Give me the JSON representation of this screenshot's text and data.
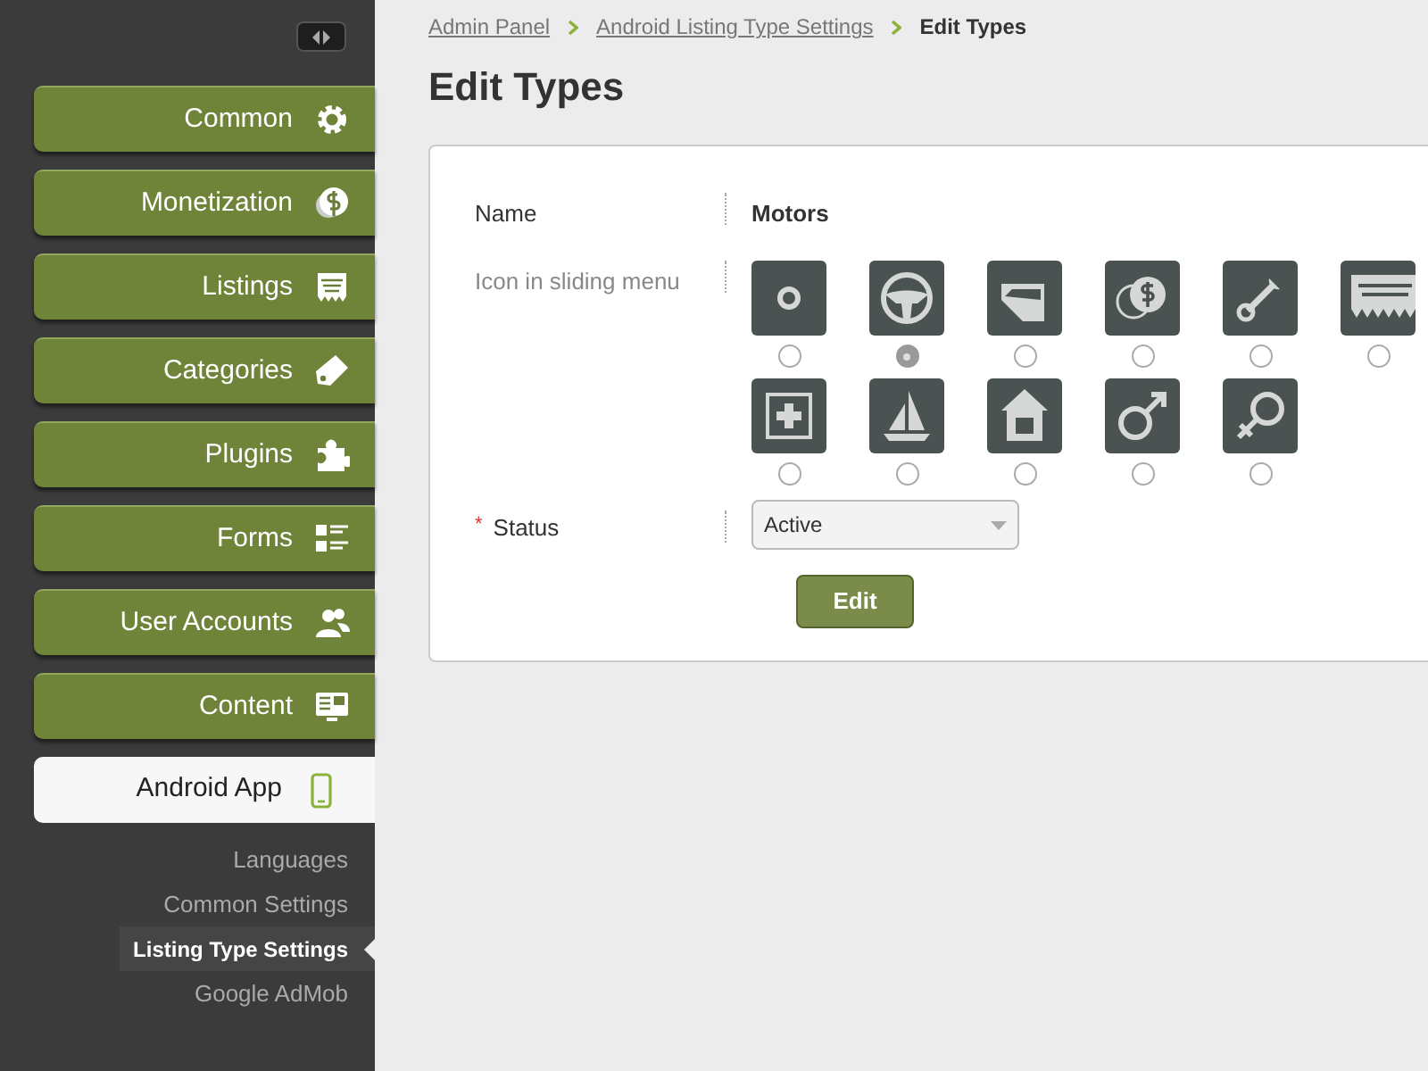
{
  "sidebar": {
    "items": [
      {
        "label": "Common",
        "kind": "gear",
        "selected": false
      },
      {
        "label": "Monetization",
        "kind": "coin",
        "selected": false
      },
      {
        "label": "Listings",
        "kind": "listing",
        "selected": false
      },
      {
        "label": "Categories",
        "kind": "tag",
        "selected": false
      },
      {
        "label": "Plugins",
        "kind": "puzzle",
        "selected": false
      },
      {
        "label": "Forms",
        "kind": "checklist",
        "selected": false
      },
      {
        "label": "User Accounts",
        "kind": "users",
        "selected": false
      },
      {
        "label": "Content",
        "kind": "screen",
        "selected": false
      },
      {
        "label": "Android App",
        "kind": "phone",
        "selected": true,
        "children": [
          {
            "label": "Languages",
            "selected": false
          },
          {
            "label": "Common Settings",
            "selected": false
          },
          {
            "label": "Listing Type Settings",
            "selected": true
          },
          {
            "label": "Google AdMob",
            "selected": false
          }
        ]
      }
    ]
  },
  "breadcrumb": [
    {
      "label": "Admin Panel",
      "kind": "link"
    },
    {
      "label": "Android Listing Type Settings",
      "kind": "link"
    },
    {
      "label": "Edit Types",
      "kind": "current"
    }
  ],
  "title": "Edit Types",
  "form": {
    "name": {
      "label": "Name",
      "value": "Motors"
    },
    "icon_field": {
      "label": "Icon in sliding menu",
      "icons": [
        {
          "kind": "ring",
          "selected": false
        },
        {
          "kind": "wheel",
          "selected": true
        },
        {
          "kind": "door",
          "selected": false
        },
        {
          "kind": "coins",
          "selected": false
        },
        {
          "kind": "wrench",
          "selected": false
        },
        {
          "kind": "listing",
          "selected": false
        },
        {
          "kind": "medical",
          "selected": false
        },
        {
          "kind": "sailboat",
          "selected": false
        },
        {
          "kind": "house",
          "selected": false
        },
        {
          "kind": "male",
          "selected": false
        },
        {
          "kind": "female",
          "selected": false
        }
      ]
    },
    "status": {
      "label": "Status",
      "required_mark": "*",
      "value": "Active"
    },
    "submit": "Edit"
  }
}
